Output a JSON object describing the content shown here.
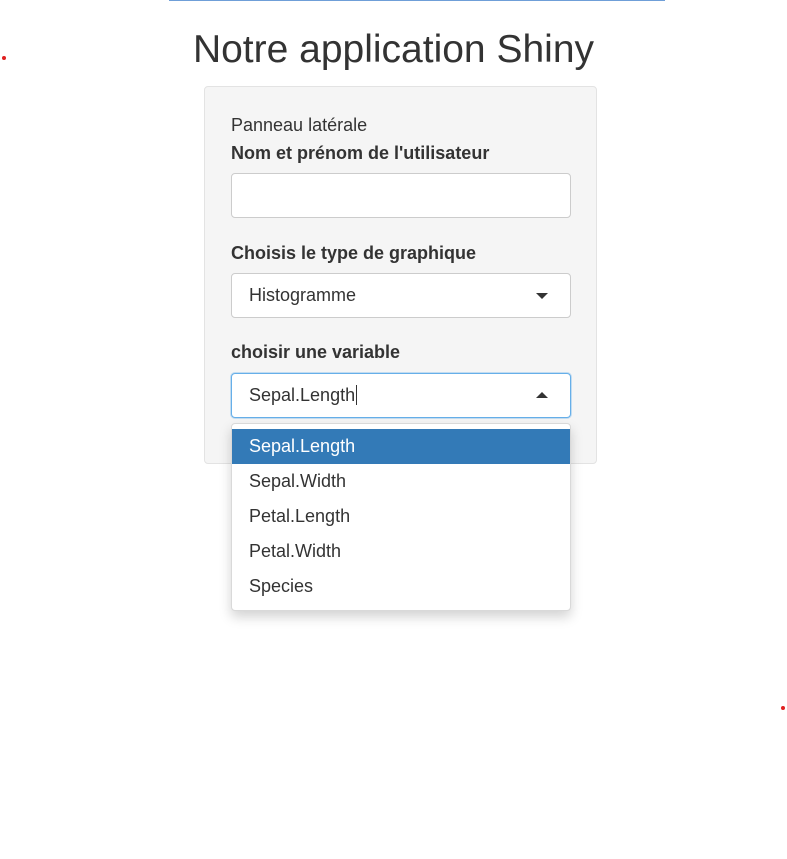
{
  "header": {
    "title": "Notre application Shiny"
  },
  "sidebar": {
    "caption": "Panneau latérale",
    "name_field": {
      "label": "Nom et prénom de l'utilisateur",
      "value": "",
      "placeholder": ""
    },
    "chart_type": {
      "label": "Choisis le type de graphique",
      "selected": "Histogramme",
      "icon": "chevron-down-icon"
    },
    "variable": {
      "label": "choisir une variable",
      "selected": "Sepal.Length",
      "icon": "chevron-up-icon",
      "options": [
        {
          "label": "Sepal.Length",
          "active": true
        },
        {
          "label": "Sepal.Width",
          "active": false
        },
        {
          "label": "Petal.Length",
          "active": false
        },
        {
          "label": "Petal.Width",
          "active": false
        },
        {
          "label": "Species",
          "active": false
        }
      ]
    }
  },
  "colors": {
    "accent": "#337ab7",
    "focus_border": "#66afe9",
    "panel_background": "#f5f5f5",
    "text": "#333333",
    "marker_dot": "#e02020"
  }
}
